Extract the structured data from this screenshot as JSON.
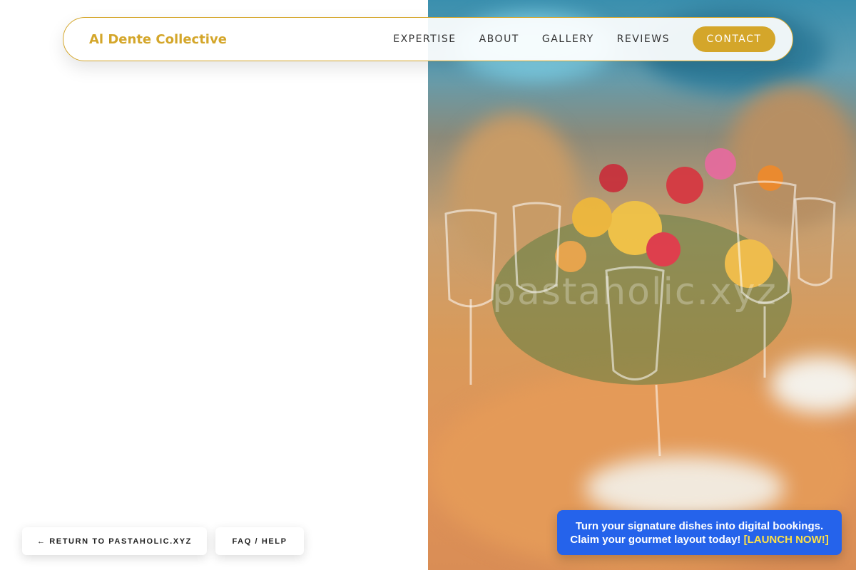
{
  "brand": {
    "name": "Al Dente Collective",
    "color": "#d4a62a"
  },
  "nav": {
    "links": [
      "EXPERTISE",
      "ABOUT",
      "GALLERY",
      "REVIEWS"
    ],
    "contact_label": "CONTACT"
  },
  "hero": {
    "watermark": "pastaholic.xyz"
  },
  "footer_buttons": {
    "return_label": "← RETURN TO PASTAHOLIC.XYZ",
    "faq_label": "FAQ / HELP"
  },
  "promo": {
    "line1": "Turn your signature dishes into digital bookings.",
    "line2": "Claim your gourmet layout today!",
    "cta": "[LAUNCH NOW!]",
    "background": "#2563eb",
    "cta_color": "#fde047"
  }
}
